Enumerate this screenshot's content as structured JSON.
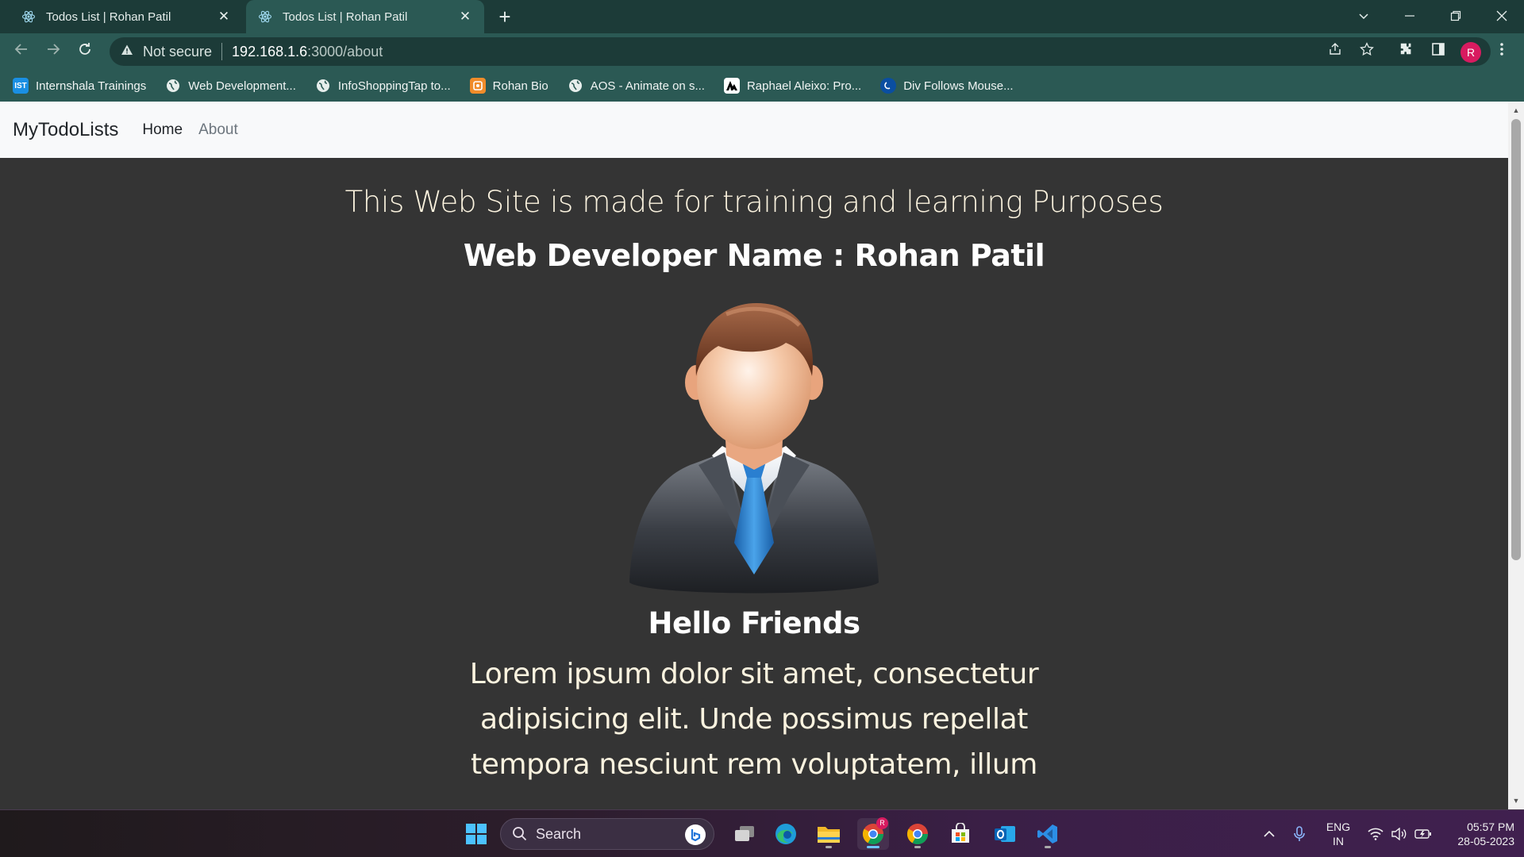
{
  "browser": {
    "tabs": [
      {
        "title": "Todos List | Rohan Patil",
        "active": false
      },
      {
        "title": "Todos List | Rohan Patil",
        "active": true
      }
    ],
    "security_label": "Not secure",
    "url_host": "192.168.1.6",
    "url_path": ":3000/about",
    "profile_initial": "R",
    "bookmarks": [
      {
        "label": "Internshala Trainings",
        "icon": "internshala-icon"
      },
      {
        "label": "Web Development...",
        "icon": "globe-icon"
      },
      {
        "label": "InfoShoppingTap to...",
        "icon": "globe-icon"
      },
      {
        "label": "Rohan Bio",
        "icon": "bio-icon"
      },
      {
        "label": "AOS - Animate on s...",
        "icon": "globe-icon"
      },
      {
        "label": "Raphael Aleixo: Pro...",
        "icon": "ra-icon"
      },
      {
        "label": "Div Follows Mouse...",
        "icon": "codepen-icon"
      }
    ]
  },
  "navbar": {
    "brand": "MyTodoLists",
    "links": [
      "Home",
      "About"
    ]
  },
  "about": {
    "tagline": "This Web Site is made for training and learning Purposes",
    "developer": "Web Developer Name : Rohan Patil",
    "greeting": "Hello Friends",
    "body": "Lorem ipsum dolor sit amet, consectetur adipisicing elit. Unde possimus repellat tempora nesciunt rem voluptatem, illum"
  },
  "taskbar": {
    "search_placeholder": "Search",
    "lang_line1": "ENG",
    "lang_line2": "IN",
    "time": "05:57 PM",
    "date": "28-05-2023",
    "chrome_badge": "R"
  },
  "colors": {
    "chrome_dark": "#1c3b38",
    "chrome_mid": "#2b5954",
    "page_bg": "#343434",
    "navbar_bg": "#f8f9fa",
    "text_cream": "#fbf3df"
  }
}
